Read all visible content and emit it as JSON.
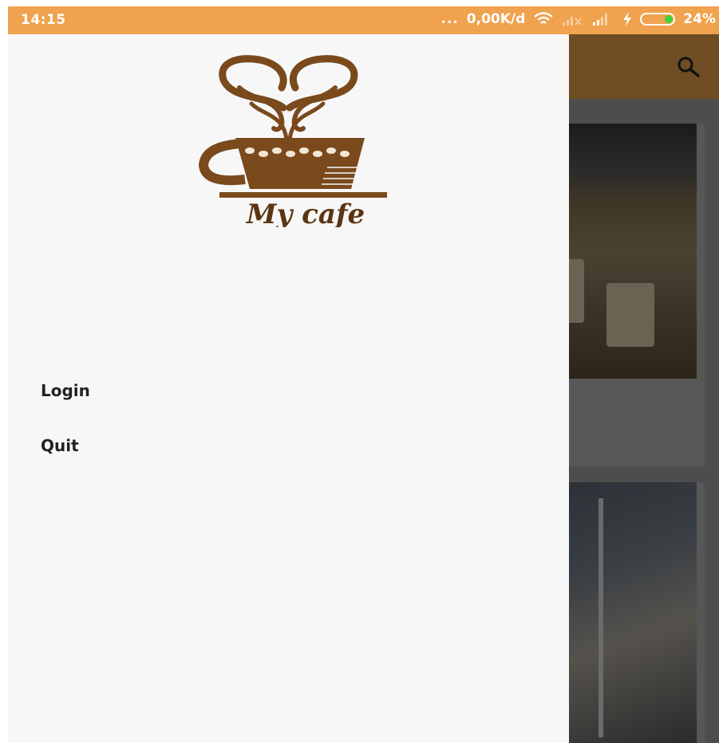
{
  "status_bar": {
    "time": "14:15",
    "dots": "...",
    "network_speed": "0,00K/d",
    "battery_percent": "24%"
  },
  "drawer": {
    "logo_text": "My cafe",
    "menu": [
      {
        "label": "Login"
      },
      {
        "label": "Quit"
      }
    ]
  },
  "colors": {
    "status_bar": "#f0a24e",
    "toolbar": "#6e4d22",
    "drawer_bg": "#f7f7f7",
    "logo_brown": "#7a4a1c",
    "scrim": "#4d4d4d"
  },
  "icons": {
    "search": "search-icon",
    "wifi": "wifi-icon",
    "signal": "signal-icon",
    "charging": "charging-icon",
    "battery": "battery-icon"
  }
}
